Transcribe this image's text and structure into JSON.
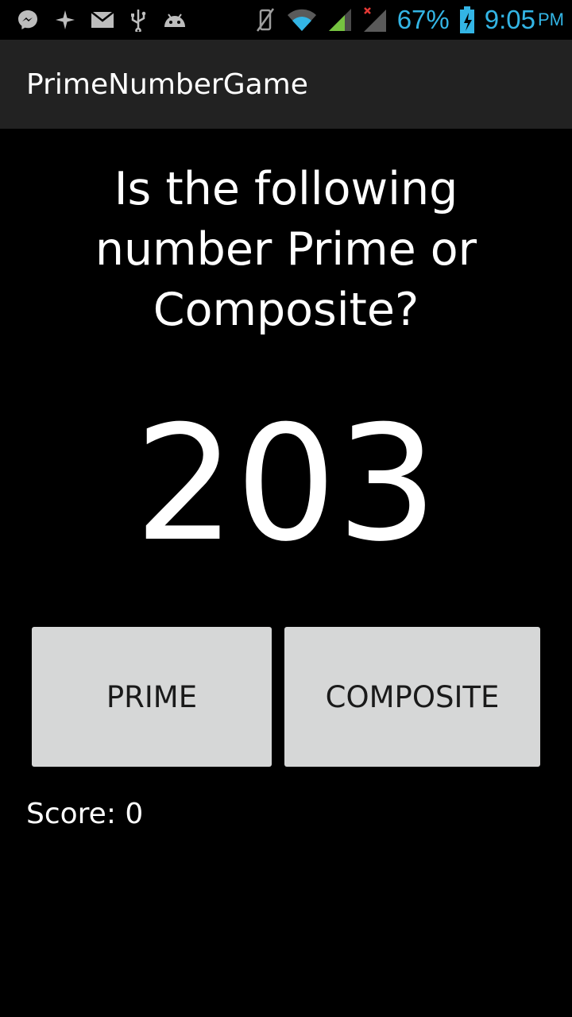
{
  "status_bar": {
    "left_icons": [
      "messenger-icon",
      "sparkle-icon",
      "mail-icon",
      "usb-icon",
      "android-icon"
    ],
    "right_icons": [
      "mute-icon",
      "wifi-icon",
      "signal-icon",
      "signal-no-service-icon",
      "battery-charging-icon"
    ],
    "battery_percent": "67%",
    "time": "9:05",
    "ampm": "PM",
    "accent_color": "#33b5e5"
  },
  "app": {
    "title": "PrimeNumberGame"
  },
  "game": {
    "question": "Is the following number Prime or Composite?",
    "number": "203",
    "prime_button_label": "PRIME",
    "composite_button_label": "COMPOSITE",
    "score_label": "Score:",
    "score_value": "0"
  }
}
